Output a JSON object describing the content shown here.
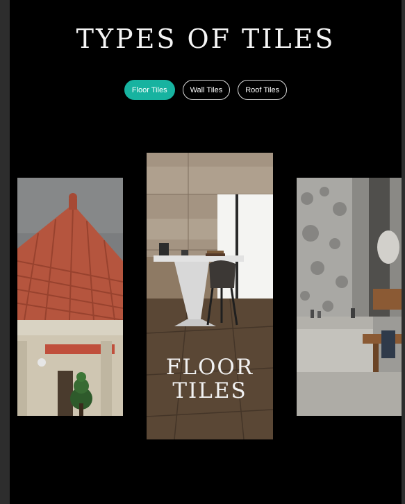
{
  "page": {
    "heading": "TYPES OF TILES"
  },
  "tabs": [
    {
      "label": "Floor Tiles",
      "active": true
    },
    {
      "label": "Wall Tiles",
      "active": false
    },
    {
      "label": "Roof Tiles",
      "active": false
    }
  ],
  "cards": {
    "center": {
      "title_line1": "FLOOR",
      "title_line2": "TILES"
    }
  },
  "colors": {
    "accent": "#17b3a0",
    "background": "#000000",
    "text": "#f4f4f4"
  }
}
